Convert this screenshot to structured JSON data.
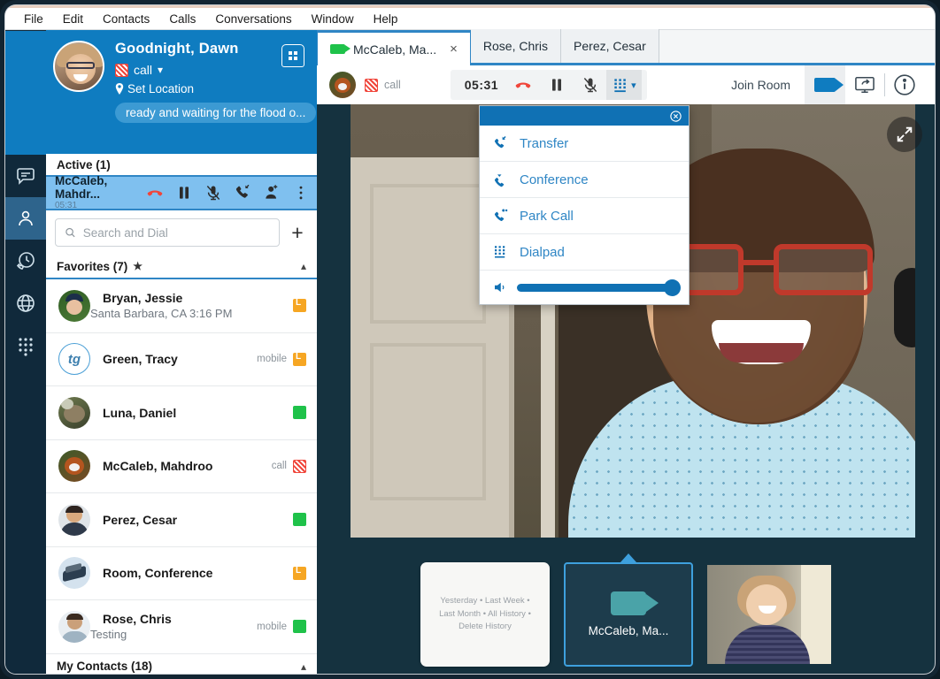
{
  "menu": {
    "items": [
      "File",
      "Edit",
      "Contacts",
      "Calls",
      "Conversations",
      "Window",
      "Help"
    ]
  },
  "rail": {
    "items": [
      {
        "name": "chat-icon",
        "label": "Chat"
      },
      {
        "name": "contacts-icon",
        "label": "Contacts",
        "selected": true
      },
      {
        "name": "call-history-icon",
        "label": "History"
      },
      {
        "name": "globe-icon",
        "label": "Directory"
      },
      {
        "name": "dialpad-icon",
        "label": "Dialpad"
      }
    ]
  },
  "profile": {
    "name": "Goodnight, Dawn",
    "status": "call",
    "location": "Set Location",
    "message": "ready and waiting for the flood o...",
    "office_button": "office-icon"
  },
  "active": {
    "header": "Active (1)",
    "caller": "McCaleb, Mahdr...",
    "duration": "05:31"
  },
  "search": {
    "placeholder": "Search and Dial",
    "value": "",
    "add_label": "+"
  },
  "favorites": {
    "header": "Favorites (7)",
    "contacts": [
      {
        "name": "Bryan, Jessie",
        "sub": "Santa Barbara, CA 3:16 PM",
        "label": "",
        "presence": "away"
      },
      {
        "name": "Green, Tracy",
        "sub": "",
        "label": "mobile",
        "presence": "away",
        "initials": "tg"
      },
      {
        "name": "Luna, Daniel",
        "sub": "",
        "label": "",
        "presence": "green"
      },
      {
        "name": "McCaleb, Mahdroo",
        "sub": "",
        "label": "call",
        "presence": "dnd"
      },
      {
        "name": "Perez, Cesar",
        "sub": "",
        "label": "",
        "presence": "green"
      },
      {
        "name": "Room, Conference",
        "sub": "",
        "label": "",
        "presence": "away"
      },
      {
        "name": "Rose, Chris",
        "sub": "Testing",
        "label": "mobile",
        "presence": "green"
      }
    ]
  },
  "my_contacts": {
    "header": "My Contacts (18)"
  },
  "tabs": [
    {
      "label": "McCaleb, Ma...",
      "active": true,
      "close": "×"
    },
    {
      "label": "Rose, Chris",
      "active": false
    },
    {
      "label": "Perez, Cesar",
      "active": false
    }
  ],
  "callbar": {
    "status": "call",
    "timer": "05:31",
    "join_room": "Join Room"
  },
  "popup": {
    "items": [
      {
        "label": "Transfer",
        "icon": "transfer-call-icon"
      },
      {
        "label": "Conference",
        "icon": "conference-call-icon"
      },
      {
        "label": "Park Call",
        "icon": "park-call-icon"
      },
      {
        "label": "Dialpad",
        "icon": "dialpad-icon"
      }
    ],
    "volume": 100
  },
  "thumbnails": {
    "history_lines": [
      "Yesterday • Last Week •",
      "Last Month • All History •",
      "Delete History"
    ],
    "active_label": "McCaleb, Ma..."
  },
  "colors": {
    "brand_blue": "#0f7cc0",
    "accent_blue": "#2f86c5",
    "presence_green": "#1fc24a",
    "presence_away": "#f6a623",
    "presence_dnd": "#f0453a",
    "stage_bg": "#15323f"
  }
}
